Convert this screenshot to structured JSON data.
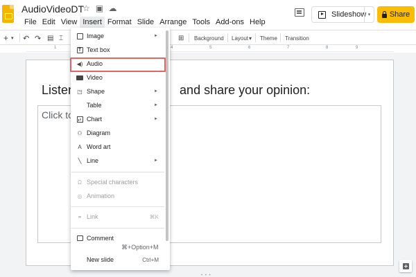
{
  "header": {
    "doc_title": "AudioVideoDT",
    "title_icons": {
      "star": "☆",
      "move": "▣",
      "cloud": "☁"
    },
    "menu": [
      "File",
      "Edit",
      "View",
      "Insert",
      "Format",
      "Slide",
      "Arrange",
      "Tools",
      "Add-ons",
      "Help"
    ],
    "active_menu": "Insert",
    "slideshow_label": "Slideshow",
    "slideshow_caret": "▾",
    "share_label": "Share",
    "accent": "#fbbc04"
  },
  "toolbar": {
    "add_symbol": "+",
    "add_caret": "▾",
    "background_label": "Background",
    "layout_label": "Layout",
    "layout_caret": "▾",
    "theme_label": "Theme",
    "transition_label": "Transition",
    "undo_icon": "↶",
    "redo_icon": "↷",
    "comment_icon": "⊞"
  },
  "ruler": {
    "numbers": [
      "1",
      "2",
      "3",
      "4",
      "5",
      "6",
      "7",
      "8",
      "9"
    ]
  },
  "slide": {
    "title_prefix": "Listen",
    "title_suffix": "and share your opinion:",
    "body_placeholder": "Click to"
  },
  "insert_menu": {
    "items": [
      {
        "label": "Image",
        "icon": "image-icon",
        "glyph": "▣",
        "submenu": true
      },
      {
        "label": "Text box",
        "icon": "text-box-icon",
        "glyph": "T",
        "submenu": false
      },
      {
        "label": "Audio",
        "icon": "speaker-icon",
        "glyph": "◀)",
        "submenu": false,
        "highlighted": true
      },
      {
        "label": "Video",
        "icon": "video-icon",
        "glyph": "",
        "submenu": false
      },
      {
        "label": "Shape",
        "icon": "shape-icon",
        "glyph": "◳",
        "submenu": true
      },
      {
        "label": "Table",
        "icon": "",
        "glyph": "",
        "submenu": true
      },
      {
        "label": "Chart",
        "icon": "chart-icon",
        "glyph": "",
        "submenu": true
      },
      {
        "label": "Diagram",
        "icon": "diagram-icon",
        "glyph": "⚇",
        "submenu": false
      },
      {
        "label": "Word art",
        "icon": "word-art-icon",
        "glyph": "A",
        "submenu": false
      },
      {
        "label": "Line",
        "icon": "line-icon",
        "glyph": "╲",
        "submenu": true
      },
      {
        "label": "Special characters",
        "icon": "omega-icon",
        "glyph": "Ω",
        "submenu": false,
        "disabled": true
      },
      {
        "label": "Animation",
        "icon": "animation-icon",
        "glyph": "◎",
        "submenu": false,
        "disabled": true
      },
      {
        "label": "Link",
        "icon": "link-icon",
        "glyph": "⚭",
        "submenu": false,
        "disabled": true,
        "shortcut": "⌘K"
      },
      {
        "label": "Comment",
        "icon": "comment-icon",
        "glyph": "",
        "submenu": false,
        "shortcut": "⌘+Option+M"
      },
      {
        "label": "New slide",
        "icon": "",
        "glyph": "",
        "submenu": false,
        "shortcut": "Ctrl+M"
      }
    ],
    "submenu_arrow": "►",
    "highlight_color": "#e06666"
  },
  "bottom_handle": "• • •"
}
